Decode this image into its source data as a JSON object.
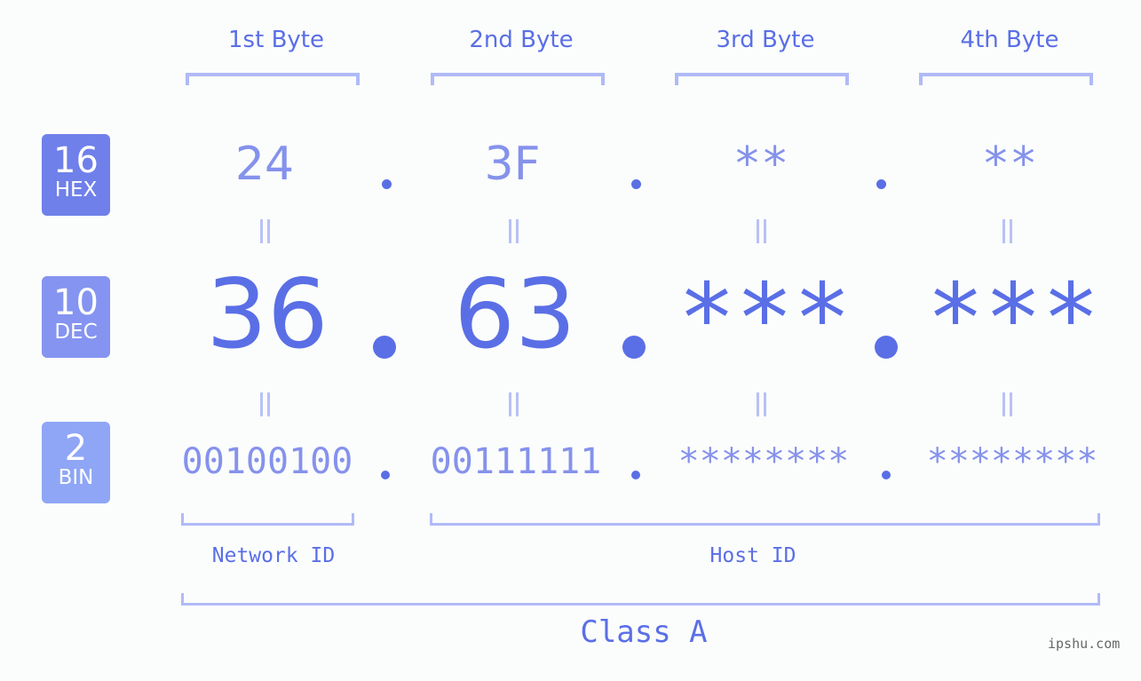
{
  "byte_headers": [
    "1st Byte",
    "2nd Byte",
    "3rd Byte",
    "4th Byte"
  ],
  "badges": {
    "hex": {
      "num": "16",
      "label": "HEX",
      "color": "#6f80ea"
    },
    "dec": {
      "num": "10",
      "label": "DEC",
      "color": "#8594f0"
    },
    "bin": {
      "num": "2",
      "label": "BIN",
      "color": "#8fa6f6"
    }
  },
  "hex": [
    "24",
    "3F",
    "**",
    "**"
  ],
  "dec": [
    "36",
    "63",
    "***",
    "***"
  ],
  "bin": [
    "00100100",
    "00111111",
    "********",
    "********"
  ],
  "labels": {
    "network": "Network ID",
    "host": "Host ID",
    "class": "Class A"
  },
  "watermark": "ipshu.com",
  "colors": {
    "accent": "#5a6fe6",
    "light": "#8592ec",
    "bracket": "#b0baf7",
    "background": "#fbfdfc"
  }
}
